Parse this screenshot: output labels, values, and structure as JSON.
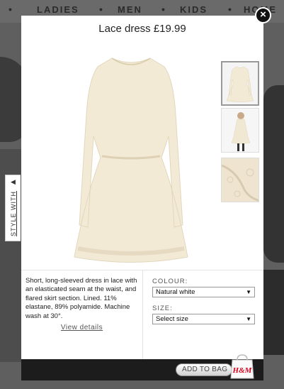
{
  "background_nav": {
    "items": [
      "LADIES",
      "MEN",
      "KIDS",
      "HOME"
    ],
    "separator": "•"
  },
  "modal": {
    "title": "Lace dress £19.99",
    "close_symbol": "×",
    "style_with_label": "STYLE WITH",
    "style_with_arrow": "◀",
    "description": "Short, long-sleeved dress in lace with an elasticated seam at the waist, and flared skirt section. Lined. 11% elastane, 89% polyamide. Machine wash at 30°.",
    "view_details_label": "View details",
    "colour": {
      "label": "COLOUR:",
      "selected": "Natural white"
    },
    "size": {
      "label": "SIZE:",
      "selected": "Select size"
    },
    "add_to_bag_label": "ADD TO BAG",
    "brand_logo": "H&M",
    "colors": {
      "dress": "#f3ead6",
      "brand": "#d6001c"
    }
  }
}
